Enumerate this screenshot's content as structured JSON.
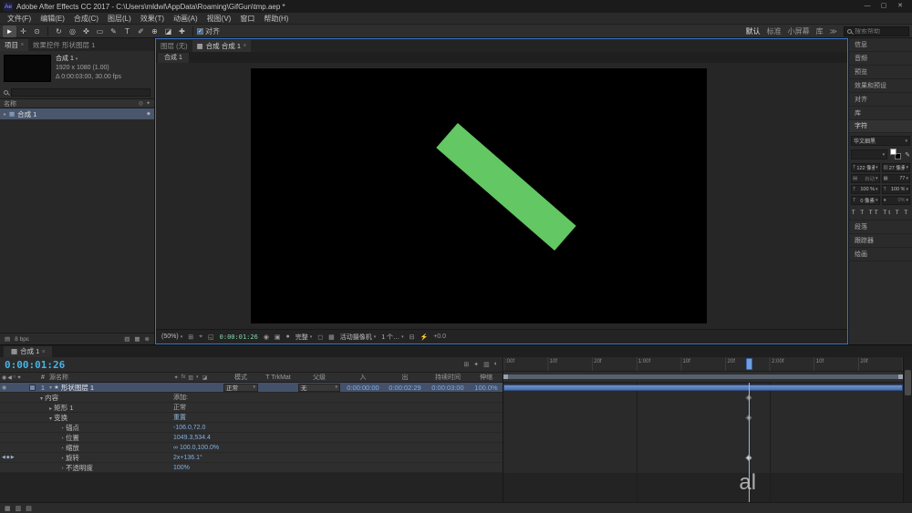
{
  "title_bar": {
    "logo": "Ae",
    "title": "Adobe After Effects CC 2017 - C:\\Users\\mldwl\\AppData\\Roaming\\GifGun\\tmp.aep *",
    "minimize": "—",
    "maximize": "▢",
    "close": "✕"
  },
  "menu": {
    "items": [
      "文件(F)",
      "编辑(E)",
      "合成(C)",
      "图层(L)",
      "效果(T)",
      "动画(A)",
      "视图(V)",
      "窗口",
      "帮助(H)"
    ]
  },
  "toolbar": {
    "tools": [
      {
        "name": "selection-tool",
        "glyph": "►"
      },
      {
        "name": "hand-tool",
        "glyph": "✛"
      },
      {
        "name": "zoom-tool",
        "glyph": "⊙"
      },
      {
        "name": "rotation-tool",
        "glyph": "↻"
      },
      {
        "name": "camera-tool",
        "glyph": "◎"
      },
      {
        "name": "pan-behind-tool",
        "glyph": "✜"
      },
      {
        "name": "shape-tool",
        "glyph": "▭"
      },
      {
        "name": "pen-tool",
        "glyph": "✎"
      },
      {
        "name": "type-tool",
        "glyph": "T"
      },
      {
        "name": "brush-tool",
        "glyph": "✐"
      },
      {
        "name": "clone-stamp-tool",
        "glyph": "⊕"
      },
      {
        "name": "eraser-tool",
        "glyph": "◪"
      },
      {
        "name": "puppet-pin-tool",
        "glyph": "✚"
      }
    ],
    "snap_check": "✓",
    "snap_label": "对齐",
    "workspaces": [
      "默认",
      "标准",
      "小屏幕",
      "库"
    ],
    "more": "≫",
    "search_placeholder": "搜索帮助"
  },
  "project": {
    "tab_project": "项目",
    "tab_effect_controls": "效果控件 形状图层 1",
    "comp_name": "合成 1",
    "comp_res": "1920 x 1080 (1.00)",
    "comp_time": "Δ 0:00:03:00, 30.00 fps",
    "name_column": "名称",
    "item_comp": "合成 1",
    "bpc": "8 bpc"
  },
  "viewer": {
    "tab_layer": "图层 (无)",
    "tab_comp": "合成 合成 1",
    "mini_tab": "合成 1",
    "zoom": "(50%)",
    "timecode": "0:00:01:26",
    "resolution": "完整",
    "camera": "活动摄像机",
    "layout": "1 个…",
    "exposure": "+0.0"
  },
  "right": {
    "panels_top": [
      "信息",
      "音频",
      "预览",
      "效果和预设",
      "对齐",
      "库"
    ],
    "character": {
      "title": "字符",
      "font_family": "华文细黑",
      "font_size": "122 像素",
      "stroke_width": "27 像素",
      "leading": "自动",
      "tracking": "77",
      "vertical_scale": "100 %",
      "horizontal_scale": "100 %",
      "baseline": "0 像素",
      "tsume": "0%",
      "faux": "T T TT Tt T T"
    },
    "panels_bottom": [
      "段落",
      "跟踪器",
      "绘画"
    ]
  },
  "timeline": {
    "tab": "合成 1",
    "timecode": "0:00:01:26",
    "headers": {
      "source_name": "源名称",
      "mode": "模式",
      "trkmat": "T TrkMat",
      "parent": "父级",
      "in_label": "入",
      "out_label": "出",
      "duration": "持续时间",
      "stretch": "伸缩"
    },
    "layer": {
      "num": "1",
      "name": "形状图层 1",
      "mode": "正常",
      "parent": "无",
      "in_val": "0:00:00:00",
      "out_val": "0:00:02:29",
      "duration": "0:00:03:00",
      "stretch": "100.0%"
    },
    "props": [
      {
        "name": "内容",
        "value": "添加:"
      },
      {
        "name": "矩形 1",
        "value": "正常"
      },
      {
        "name": "变换",
        "value": "重置"
      },
      {
        "name": "锚点",
        "value": "-106.0,72.0"
      },
      {
        "name": "位置",
        "value": "1049.3,534.4"
      },
      {
        "name": "缩放",
        "value": "100.0,100.0%",
        "link": "∞"
      },
      {
        "name": "旋转",
        "value": "2x+136.1°"
      },
      {
        "name": "不透明度",
        "value": "100%"
      }
    ],
    "ruler": [
      ":00f",
      "10f",
      "20f",
      "1:00f",
      "10f",
      "20f",
      "2:00f",
      "10f",
      "20f"
    ],
    "watermark": "al"
  },
  "icons": {
    "menu": "≡",
    "caret": "▾",
    "expand": "▾",
    "collapse": "▸",
    "comp": "▦",
    "star": "★",
    "eye": "◉",
    "audio": "◀",
    "solo": "○",
    "lock": "✦",
    "stopwatch": "◔",
    "kf_prev": "◀",
    "kf_diamond": "◆",
    "kf_next": "▶",
    "shy": "✦",
    "frame_blend": "▥",
    "motion_blur": "◐",
    "adjustment": "◉",
    "three_d": "◪",
    "fx": "fx",
    "grid": "⊞",
    "crosshair": "⌖",
    "mask_vis": "◱",
    "snapshot": "◉",
    "show_snapshot": "▣",
    "channels": "●",
    "roi": "◻",
    "transparency": "▦",
    "pixel_aspect": "⊟",
    "fast_preview": "⚡",
    "interpret": "▤",
    "folder": "▧",
    "trash": "⊗",
    "sort": "◎",
    "filter": "✦",
    "pane1": "▦",
    "pane2": "▥",
    "pane3": "▤"
  },
  "colors": {
    "shape_green": "#63c763",
    "panel_accent_blue": "#3c76c8",
    "timecode_blue": "#45b4e6",
    "value_blue": "#7fb0e2"
  }
}
